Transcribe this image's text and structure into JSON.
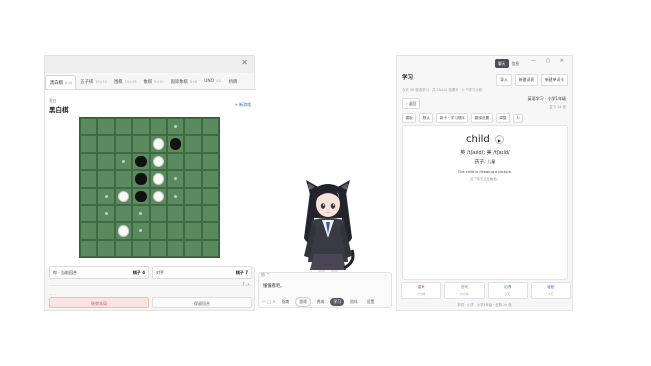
{
  "game": {
    "tabs": [
      {
        "name": "黑白棋",
        "size": "8×8"
      },
      {
        "name": "五子棋",
        "size": "15×15"
      },
      {
        "name": "围棋",
        "size": "19×19"
      },
      {
        "name": "象棋",
        "size": "9×10"
      },
      {
        "name": "国际象棋",
        "size": "8×8"
      },
      {
        "name": "UNO",
        "size": "4人"
      },
      {
        "name": "桥牌",
        "size": ""
      }
    ],
    "mode_label": "黑白",
    "title": "黑白棋",
    "new_game": "+ 新游戏",
    "board": {
      "rows": 8,
      "cols": 8,
      "pieces": [
        {
          "r": 1,
          "c": 4,
          "color": "white"
        },
        {
          "r": 1,
          "c": 5,
          "color": "black"
        },
        {
          "r": 2,
          "c": 3,
          "color": "black"
        },
        {
          "r": 2,
          "c": 4,
          "color": "white"
        },
        {
          "r": 3,
          "c": 3,
          "color": "black"
        },
        {
          "r": 3,
          "c": 4,
          "color": "white"
        },
        {
          "r": 4,
          "c": 2,
          "color": "white"
        },
        {
          "r": 4,
          "c": 3,
          "color": "black"
        },
        {
          "r": 4,
          "c": 4,
          "color": "white"
        },
        {
          "r": 6,
          "c": 2,
          "color": "white"
        }
      ],
      "hints": [
        {
          "r": 0,
          "c": 5
        },
        {
          "r": 2,
          "c": 2
        },
        {
          "r": 3,
          "c": 5
        },
        {
          "r": 4,
          "c": 1
        },
        {
          "r": 4,
          "c": 5
        },
        {
          "r": 5,
          "c": 1
        },
        {
          "r": 5,
          "c": 3
        },
        {
          "r": 6,
          "c": 3
        }
      ]
    },
    "player_black": {
      "label": "你 · 当前回合",
      "count": "棋子 4"
    },
    "player_white": {
      "label": "对手",
      "count": "棋子 7"
    },
    "arrow_hint": "↑ ⇣",
    "dash_line": "— —",
    "resign_label": "结束本局",
    "undo_label": "保留回合"
  },
  "chat": {
    "top_hint": "拾 ⌃",
    "more_icon": "⋮",
    "placeholder": "懂懂看吧。",
    "window_ctl": "— ▢ ✕",
    "modes": [
      "指南",
      "游戏",
      "养成",
      "学习",
      "陪伴",
      "设置"
    ],
    "active_mode": "学习"
  },
  "learn": {
    "seg_left": "聊天",
    "seg_right": "信息",
    "win_ctl": "— ▢ ✕",
    "title": "学习",
    "import_label": "导入",
    "add_course_label": "新建词表",
    "add_word_label": "新建单词卡",
    "stats": "今天 40 张待学习 · 共 35414 张课卡 · 2 个学习计划",
    "back_label": "‹ 返回",
    "course_title": "英语学习 · 小学1年级",
    "course_sub": "复习 24 张",
    "filters": [
      "模板",
      "默认",
      "新卡 · 学习顺序",
      "翻译设置",
      "调整",
      "↻"
    ],
    "word": "child",
    "play_icon": "▶",
    "phonetic": "英 /tʃaɪld/; 美 /tʃaɪld/",
    "meaning_label": "孩子;",
    "meaning_cn": "儿童",
    "example": "The child is drawing a picture.",
    "example_cn": "这个孩子正在画画。",
    "grades": [
      {
        "label": "重来",
        "sub": "1分钟",
        "color": "red"
      },
      {
        "label": "困难",
        "sub": "6分钟",
        "color": "orange"
      },
      {
        "label": "记得",
        "sub": "1天",
        "color": "green"
      },
      {
        "label": "轻松",
        "sub": "4天",
        "color": "blue"
      }
    ],
    "footer": "新词 · 小学 · 小学1年级 · 还剩 24 张"
  }
}
